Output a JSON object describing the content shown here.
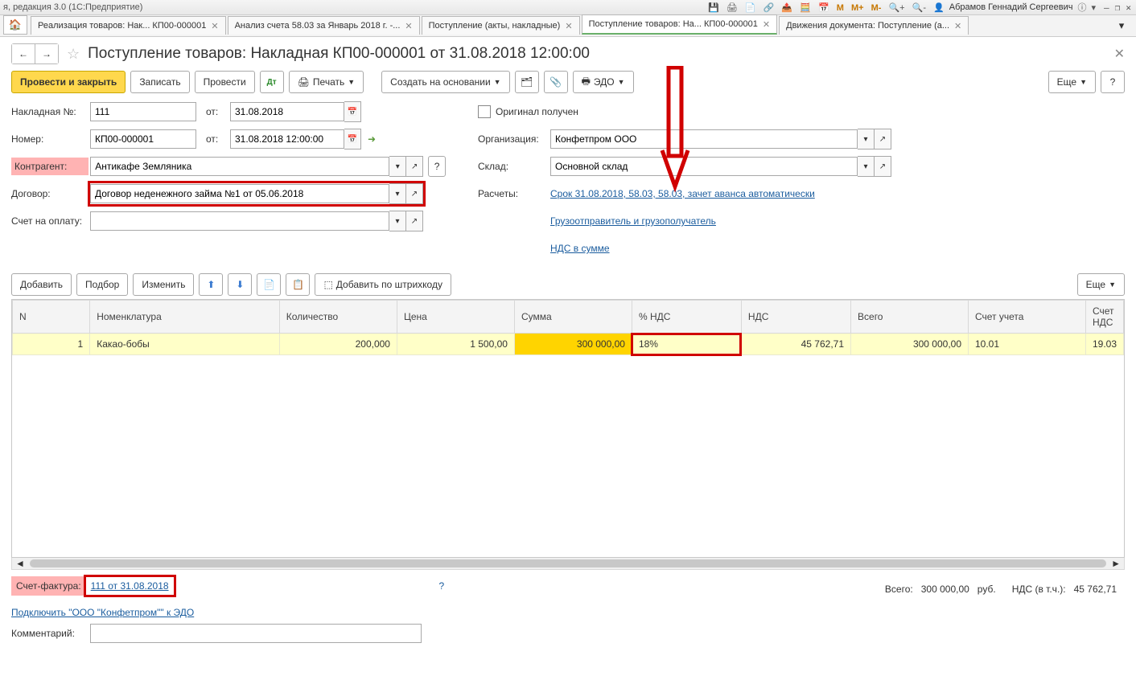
{
  "titlebar": {
    "app_title": "я, редакция 3.0  (1С:Предприятие)",
    "user": "Абрамов Геннадий Сергеевич",
    "M": "M",
    "Mplus": "M+",
    "Mminus": "M-"
  },
  "tabs": [
    {
      "label": "Реализация товаров: Нак... КП00-000001",
      "active": false
    },
    {
      "label": "Анализ счета 58.03 за Январь 2018 г. -...",
      "active": false
    },
    {
      "label": "Поступление (акты, накладные)",
      "active": false
    },
    {
      "label": "Поступление товаров: На... КП00-000001",
      "active": true
    },
    {
      "label": "Движения документа: Поступление (а...",
      "active": false
    }
  ],
  "page_title": "Поступление товаров: Накладная КП00-000001 от 31.08.2018 12:00:00",
  "toolbar": {
    "run_close": "Провести и закрыть",
    "save": "Записать",
    "run": "Провести",
    "print": "Печать",
    "create_based": "Создать на основании",
    "edo": "ЭДО",
    "more": "Еще"
  },
  "form": {
    "nakl_label": "Накладная №:",
    "nakl_value": "111",
    "ot1": "от:",
    "date1": "31.08.2018",
    "num_label": "Номер:",
    "num_value": "КП00-000001",
    "ot2": "от:",
    "date2": "31.08.2018 12:00:00",
    "contr_label": "Контрагент:",
    "contr_value": "Антикафе Земляника",
    "dog_label": "Договор:",
    "dog_value": "Договор неденежного займа №1 от 05.06.2018",
    "bill_label": "Счет на оплату:",
    "bill_value": "",
    "orig_label": "Оригинал получен",
    "org_label": "Организация:",
    "org_value": "Конфетпром ООО",
    "sklad_label": "Склад:",
    "sklad_value": "Основной склад",
    "calc_label": "Расчеты:",
    "calc_link": "Срок 31.08.2018, 58.03, 58.03, зачет аванса автоматически",
    "cons_link": "Грузоотправитель и грузополучатель",
    "nds_link": "НДС в сумме"
  },
  "table_toolbar": {
    "add": "Добавить",
    "pick": "Подбор",
    "edit": "Изменить",
    "barcode": "Добавить по штрихкоду",
    "more": "Еще"
  },
  "columns": [
    "N",
    "Номенклатура",
    "Количество",
    "Цена",
    "Сумма",
    "% НДС",
    "НДС",
    "Всего",
    "Счет учета",
    "Счет НДС"
  ],
  "rows": [
    {
      "n": "1",
      "name": "Какао-бобы",
      "qty": "200,000",
      "price": "1 500,00",
      "sum": "300 000,00",
      "vatp": "18%",
      "vat": "45 762,71",
      "total": "300 000,00",
      "acc": "10.01",
      "accvat": "19.03"
    }
  ],
  "footer": {
    "sf_label": "Счет-фактура:",
    "sf_link": "111 от 31.08.2018",
    "q": "?",
    "total_label": "Всего:",
    "total_val": "300 000,00",
    "cur": "руб.",
    "nds_label": "НДС (в т.ч.):",
    "nds_val": "45 762,71",
    "edo_link": "Подключить \"ООО \"Конфетпром\"\" к ЭДО",
    "comment_label": "Комментарий:"
  }
}
